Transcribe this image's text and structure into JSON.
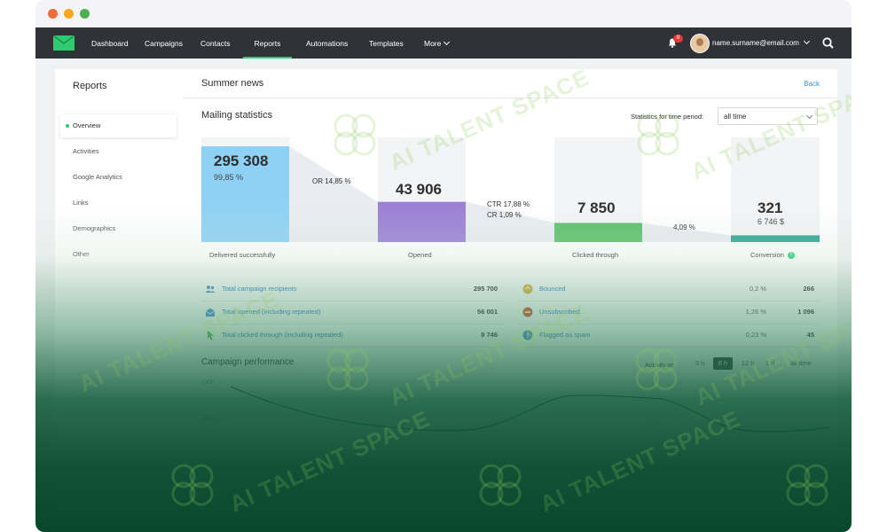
{
  "nav": {
    "items": [
      {
        "label": "Dashboard"
      },
      {
        "label": "Campaigns"
      },
      {
        "label": "Contacts"
      },
      {
        "label": "Reports"
      },
      {
        "label": "Automations"
      },
      {
        "label": "Templates"
      },
      {
        "label": "More"
      }
    ],
    "active": "Reports",
    "notification_count": "8",
    "user_email": "name.surname@email.com"
  },
  "sidebar": {
    "title": "Reports",
    "items": [
      {
        "label": "Overview"
      },
      {
        "label": "Activities"
      },
      {
        "label": "Google Analytics"
      },
      {
        "label": "Links"
      },
      {
        "label": "Demographics"
      },
      {
        "label": "Other"
      }
    ]
  },
  "page": {
    "title": "Summer news",
    "back_label": "Back",
    "section_title": "Mailing statistics",
    "period_label": "Statistics for time period:",
    "period_value": "all time"
  },
  "funnel": {
    "delivered": {
      "value": "295 308",
      "pct": "99,85 %",
      "label": "Delivered successfully",
      "level": 1.0
    },
    "or_label": "OR 14,85 %",
    "opened": {
      "value": "43 906",
      "label": "Opened",
      "level": 0.42
    },
    "ctr_label": "CTR 17,88 %",
    "cr_label": "CR 1,09 %",
    "clicked": {
      "value": "7 850",
      "label": "Clicked through",
      "level": 0.2
    },
    "conv_pct": "4,09 %",
    "conversion": {
      "value": "321",
      "amount": "6 746 $",
      "label": "Conversion",
      "level": 0.07
    },
    "colors": {
      "delivered": "#8fd1f5",
      "opened": "#9b7fd4",
      "clicked": "#5cbf6a",
      "conversion": "#2aa58f"
    }
  },
  "stats": {
    "left": [
      {
        "label": "Total campaign recipients",
        "value": "295 700",
        "icon": "users-icon"
      },
      {
        "label": "Total opened (including repeated)",
        "value": "56 001",
        "icon": "envelope-open-icon"
      },
      {
        "label": "Total clicked through (including repeated)",
        "value": "9 746",
        "icon": "cursor-icon"
      }
    ],
    "right": [
      {
        "label": "Bounced",
        "pct": "0,2 %",
        "value": "266",
        "icon": "bounce-icon"
      },
      {
        "label": "Unsubscribed",
        "pct": "1,26 %",
        "value": "1 096",
        "icon": "minus-circle-icon"
      },
      {
        "label": "Flagged as spam",
        "pct": "0,23 %",
        "value": "45",
        "icon": "spam-icon"
      }
    ]
  },
  "performance": {
    "title": "Campaign performance",
    "activity_label": "Activity in:",
    "ranges": [
      "3 h",
      "6 h",
      "12 h",
      "1 d",
      "all time"
    ],
    "active_range": "6 h",
    "y_ticks": [
      "1000",
      "1500"
    ]
  },
  "watermark": {
    "text": "AI TALENT SPACE"
  }
}
